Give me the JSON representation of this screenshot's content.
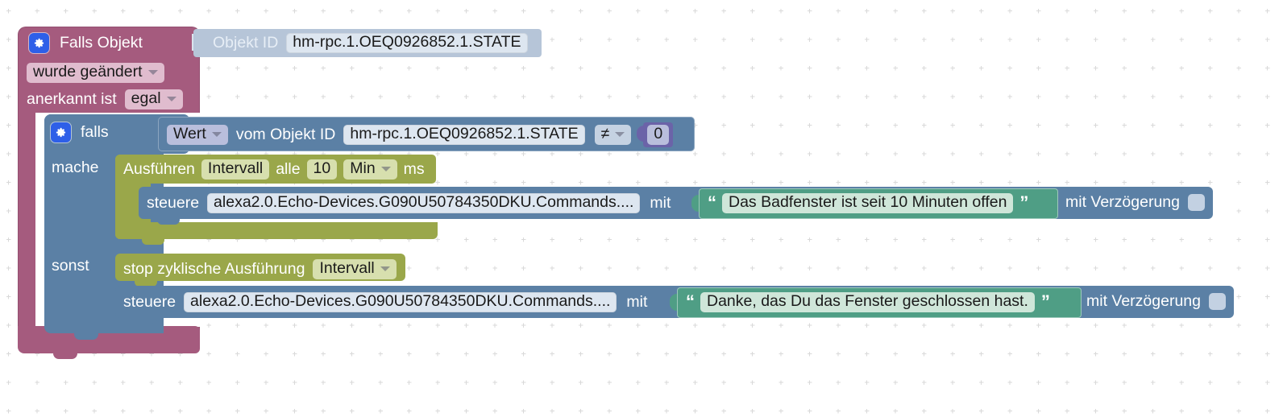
{
  "app": {
    "editor": "ioBroker Blockly Script Editor",
    "canvas_background": "#ffffff",
    "grid": "dotted-cross"
  },
  "colors": {
    "trigger_block": "#a55b7e",
    "control_block": "#5b80a5",
    "timer_block": "#9aa74a",
    "text_block": "#4f9e85",
    "math_block": "#6b63a8",
    "value_field": "#dde6f0",
    "gear_icon": "#2e5fe8"
  },
  "blocks": {
    "trigger": {
      "gear_icon": "gear-icon",
      "title": "Falls Objekt",
      "objekt_id_label": "Objekt ID",
      "objekt_id_value": "hm-rpc.1.OEQ0926852.1.STATE",
      "change_type": "wurde geändert",
      "ack_label": "anerkannt ist",
      "ack_value": "egal"
    },
    "if_block": {
      "gear_icon": "gear-icon",
      "label": "falls",
      "do_label": "mache",
      "else_label": "sonst",
      "condition": {
        "value_selector": "Wert",
        "from_label": "vom Objekt ID",
        "object_id": "hm-rpc.1.OEQ0926852.1.STATE",
        "operator": "≠",
        "compare_value": "0"
      }
    },
    "interval": {
      "run_label": "Ausführen",
      "name": "Intervall",
      "every_label": "alle",
      "amount": "10",
      "unit": "Min",
      "suffix": "ms"
    },
    "say_do": {
      "control_label": "steuere",
      "object_id": "alexa2.0.Echo-Devices.G090U50784350DKU.Commands....",
      "with_label": "mit",
      "text_value": "Das Badfenster ist seit 10 Minuten offen",
      "quote_open": "“",
      "quote_close": "”",
      "delay_label": "mit Verzögerung",
      "delay_checked": false
    },
    "stop_interval": {
      "label": "stop zyklische Ausführung",
      "name": "Intervall"
    },
    "say_else": {
      "control_label": "steuere",
      "object_id": "alexa2.0.Echo-Devices.G090U50784350DKU.Commands....",
      "with_label": "mit",
      "text_value": "Danke, das Du das Fenster geschlossen hast.",
      "quote_open": "“",
      "quote_close": "”",
      "delay_label": "mit Verzögerung",
      "delay_checked": false
    }
  }
}
